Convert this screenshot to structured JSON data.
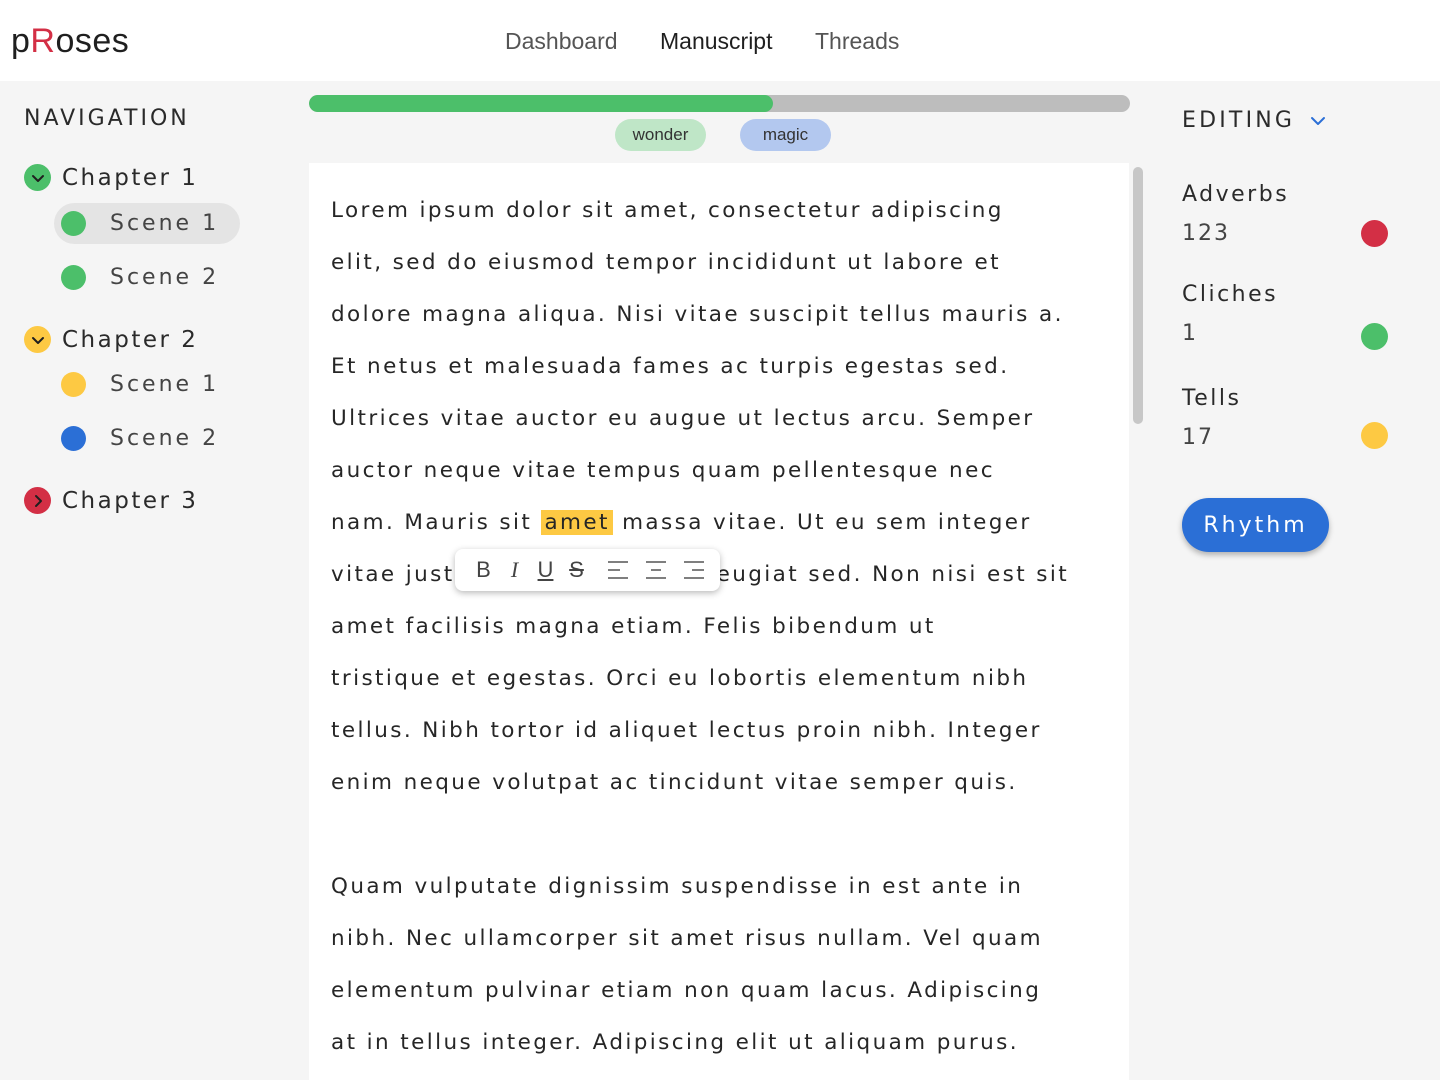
{
  "app": {
    "logo_prefix": "p",
    "logo_r": "R",
    "logo_suffix": "oses"
  },
  "topnav": {
    "items": [
      {
        "label": "Dashboard",
        "active": false
      },
      {
        "label": "Manuscript",
        "active": true
      },
      {
        "label": "Threads",
        "active": false
      }
    ]
  },
  "sidebar": {
    "title": "NAVIGATION",
    "chapters": [
      {
        "label": "Chapter 1",
        "expanded": true,
        "color": "#4cbf6a",
        "scenes": [
          {
            "label": "Scene 1",
            "color": "#4cbf6a",
            "active": true
          },
          {
            "label": "Scene 2",
            "color": "#4cbf6a",
            "active": false
          }
        ]
      },
      {
        "label": "Chapter 2",
        "expanded": true,
        "color": "#fdc943",
        "scenes": [
          {
            "label": "Scene 1",
            "color": "#fdc943",
            "active": false
          },
          {
            "label": "Scene 2",
            "color": "#2b6fd6",
            "active": false
          }
        ]
      },
      {
        "label": "Chapter 3",
        "expanded": false,
        "color": "#d32f45",
        "scenes": []
      }
    ]
  },
  "progress": {
    "fraction": 0.565,
    "fill_color": "#4cbf6a",
    "track_color": "#bdbdbd"
  },
  "tags": [
    {
      "label": "wonder",
      "color": "#bfe6c7"
    },
    {
      "label": "magic",
      "color": "#b3c8ef"
    }
  ],
  "editor": {
    "p1_before": "Lorem ipsum dolor sit amet, consectetur adipiscing elit, sed do eiusmod tempor incididunt ut labore et dolore magna aliqua. Nisi vitae suscipit tellus mauris a. Et netus et malesuada fames ac turpis egestas sed. Ultrices vitae auctor eu augue ut lectus arcu. Semper auctor neque vitae tempus quam pellentesque nec nam. Mauris sit ",
    "p1_highlight": "amet",
    "p1_after": " massa vitae. Ut eu sem integer vitae justo eget magna fermentum iaculis eu non diam. Mauris pharetra et ultrices neque ornare aenean euismod elementum. Feugiat sed. Non nisi est sit amet facilisis magna etiam. Felis bibendum ut tristique et egestas. Orci eu lobortis elementum nibh tellus. Nibh tortor id aliquet lectus proin nibh. Integer enim neque volutpat ac tincidunt vitae semper quis.",
    "p1_line1": "Lorem ipsum dolor sit amet, consectetur adipiscing",
    "p1_line2": "elit, sed do eiusmod tempor incididunt ut labore et",
    "p1_line3": "dolore magna aliqua. Nisi vitae suscipit tellus mauris a.",
    "p1_line4": "Et netus et malesuada fames ac turpis egestas sed.",
    "p1_line5": "Ultrices vitae auctor eu augue ut lectus arcu. Semper",
    "p1_line6": "auctor neque vitae tempus quam pellentesque nec",
    "p1_line7a": "nam. Mauris sit ",
    "p1_line7b": " massa vitae. Ut eu sem integer",
    "p1_line8a": "vitae just",
    "p1_line8b": "eugiat sed. Non nisi est sit",
    "p1_line9": "amet facilisis magna etiam. Felis bibendum ut",
    "p1_line10": "tristique et egestas. Orci eu lobortis elementum nibh",
    "p1_line11": "tellus. Nibh tortor id aliquet lectus proin nibh. Integer",
    "p1_line12": "enim neque volutpat ac tincidunt vitae semper quis.",
    "p2_line1": "Quam vulputate dignissim suspendisse in est ante in",
    "p2_line2": "nibh. Nec ullamcorper sit amet risus nullam. Vel quam",
    "p2_line3": "elementum pulvinar etiam non quam lacus. Adipiscing",
    "p2_line4": "at in tellus integer. Adipiscing elit ut aliquam purus.",
    "highlight_color": "#fdc943"
  },
  "format_toolbar": {
    "bold": "B",
    "italic": "I",
    "underline": "U",
    "strike": "S"
  },
  "right_panel": {
    "title": "EDITING",
    "metrics": [
      {
        "label": "Adverbs",
        "value": "123",
        "color": "#d32f45"
      },
      {
        "label": "Cliches",
        "value": "1",
        "color": "#4cbf6a"
      },
      {
        "label": "Tells",
        "value": "17",
        "color": "#fdc943"
      }
    ],
    "rhythm_label": "Rhythm"
  }
}
